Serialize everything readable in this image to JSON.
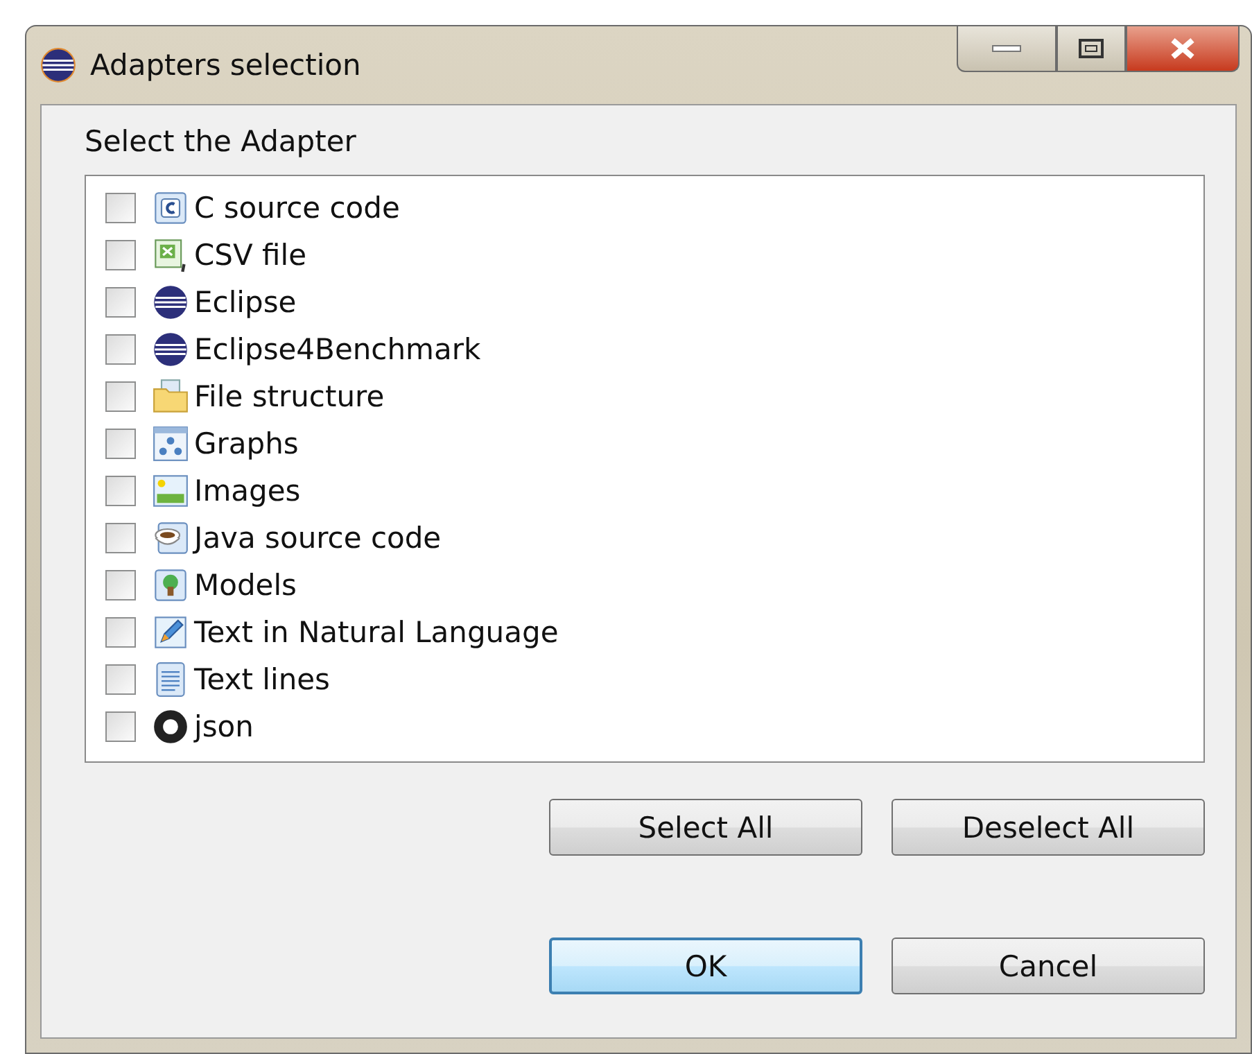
{
  "window": {
    "title": "Adapters selection"
  },
  "prompt": "Select the Adapter",
  "adapters": [
    {
      "label": "C source code",
      "kind": "c",
      "checked": false
    },
    {
      "label": "CSV file",
      "kind": "csv",
      "checked": false
    },
    {
      "label": "Eclipse",
      "kind": "eclipse",
      "checked": false
    },
    {
      "label": "Eclipse4Benchmark",
      "kind": "eclipse",
      "checked": false
    },
    {
      "label": "File structure",
      "kind": "folder",
      "checked": false
    },
    {
      "label": "Graphs",
      "kind": "graph",
      "checked": false
    },
    {
      "label": "Images",
      "kind": "image",
      "checked": false
    },
    {
      "label": "Java source code",
      "kind": "java",
      "checked": false
    },
    {
      "label": "Models",
      "kind": "model",
      "checked": false
    },
    {
      "label": "Text in Natural Language",
      "kind": "pen",
      "checked": false
    },
    {
      "label": "Text lines",
      "kind": "text",
      "checked": false
    },
    {
      "label": "json",
      "kind": "json",
      "checked": false
    }
  ],
  "selection_buttons": [
    {
      "label": "Select All",
      "default": false
    },
    {
      "label": "Deselect All",
      "default": false
    }
  ],
  "dialog_buttons": [
    {
      "label": "OK",
      "default": true
    },
    {
      "label": "Cancel",
      "default": false
    }
  ]
}
